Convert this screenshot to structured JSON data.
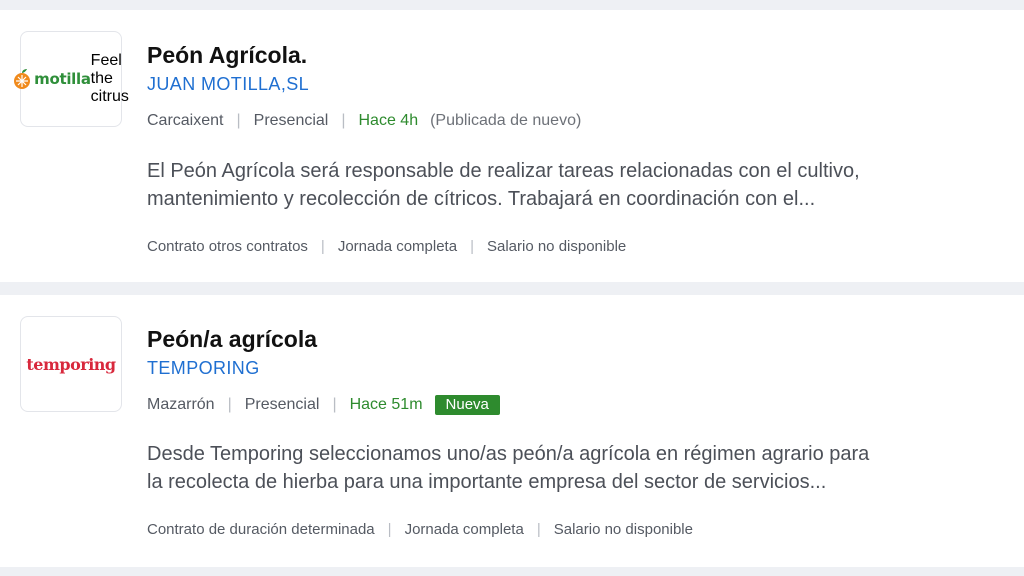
{
  "jobs": [
    {
      "logo_text": "motilla",
      "logo_tagline": "Feel the citrus",
      "title": "Peón Agrícola.",
      "company": "JUAN MOTILLA,SL",
      "location": "Carcaixent",
      "work_mode": "Presencial",
      "posted": "Hace 4h",
      "republished": "(Publicada de nuevo)",
      "description": "El Peón Agrícola será responsable de realizar tareas relacionadas con el cultivo,\nmantenimiento y recolección de cítricos. Trabajará en coordinación con el...",
      "contract": "Contrato otros contratos",
      "schedule": "Jornada completa",
      "salary": "Salario no disponible"
    },
    {
      "logo_text": "temporing",
      "title": "Peón/a agrícola",
      "company": "TEMPORING",
      "location": "Mazarrón",
      "work_mode": "Presencial",
      "posted": "Hace 51m",
      "badge": "Nueva",
      "description": "Desde Temporing seleccionamos uno/as peón/a agrícola en régimen agrario para\nla recolecta de hierba para una importante empresa del sector de servicios...",
      "contract": "Contrato de duración determinada",
      "schedule": "Jornada completa",
      "salary": "Salario no disponible"
    }
  ],
  "colors": {
    "company_link": "#1f6fd1",
    "posted_time": "#2e8b2e",
    "badge_bg": "#2e8b2e",
    "motilla_green": "#2f8f3a",
    "motilla_orange": "#f08a1c",
    "temporing_red": "#d8283c"
  },
  "icons": {
    "motilla_logo_mark": "orange-fruit-icon"
  }
}
